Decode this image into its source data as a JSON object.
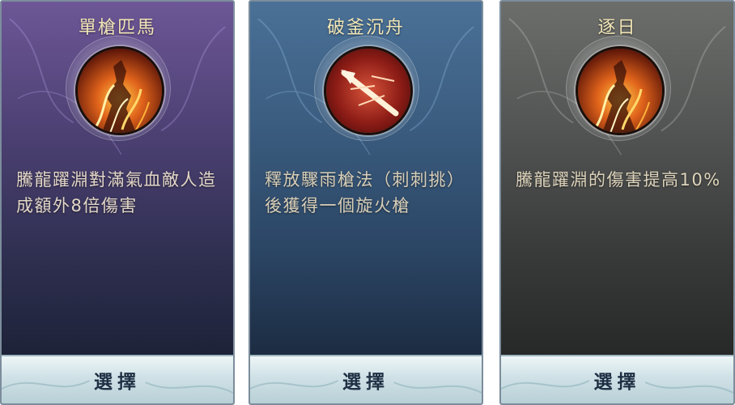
{
  "cards": [
    {
      "title": "單槍匹馬",
      "icon": "flame-warrior-icon",
      "description": "騰龍躍淵對滿氣血敵人造成額外8倍傷害",
      "button_label": "選擇"
    },
    {
      "title": "破釜沉舟",
      "icon": "fire-spear-icon",
      "description": "釋放驟雨槍法（刺刺挑）後獲得一個旋火槍",
      "button_label": "選擇"
    },
    {
      "title": "逐日",
      "icon": "flame-warrior-icon",
      "description": "騰龍躍淵的傷害提高10%",
      "button_label": "選擇"
    }
  ],
  "colors": {
    "title_gold": "#f1e6b6",
    "purple_card": "#4f4276",
    "blue_card": "#3b5d80",
    "grey_card": "#545655",
    "button_text": "#1f2f44"
  }
}
